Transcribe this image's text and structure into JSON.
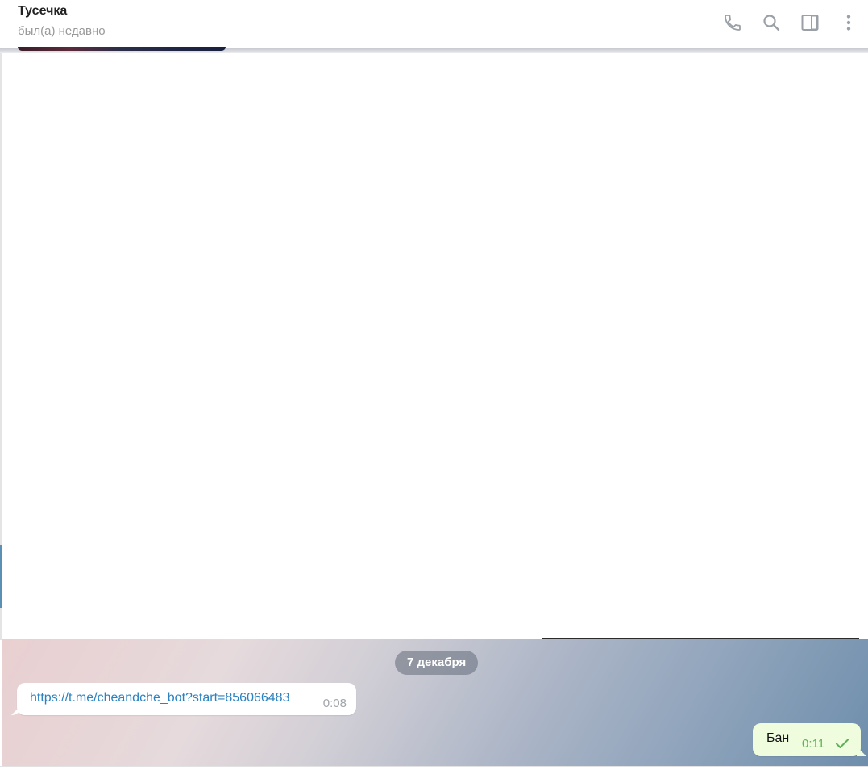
{
  "header": {
    "title": "Тусечка",
    "status": "был(а) недавно",
    "actions": [
      {
        "icon": "phone-icon"
      },
      {
        "icon": "search-icon"
      },
      {
        "icon": "sidebar-toggle-icon"
      },
      {
        "icon": "more-vertical-icon"
      }
    ]
  },
  "chat": {
    "date_separator": "7 декабря",
    "messages": [
      {
        "direction": "incoming",
        "text": "https://t.me/cheandche_bot?start=856066483",
        "time": "0:08"
      },
      {
        "direction": "outgoing",
        "text": "Бан",
        "time": "0:11",
        "status_icon": "check-icon"
      }
    ]
  },
  "colors": {
    "accent": "#2a82c0",
    "outgoing_bubble": "#effdde",
    "outgoing_time": "#5fb05a",
    "incoming_bubble": "#ffffff",
    "date_pill": "#6e7682"
  }
}
